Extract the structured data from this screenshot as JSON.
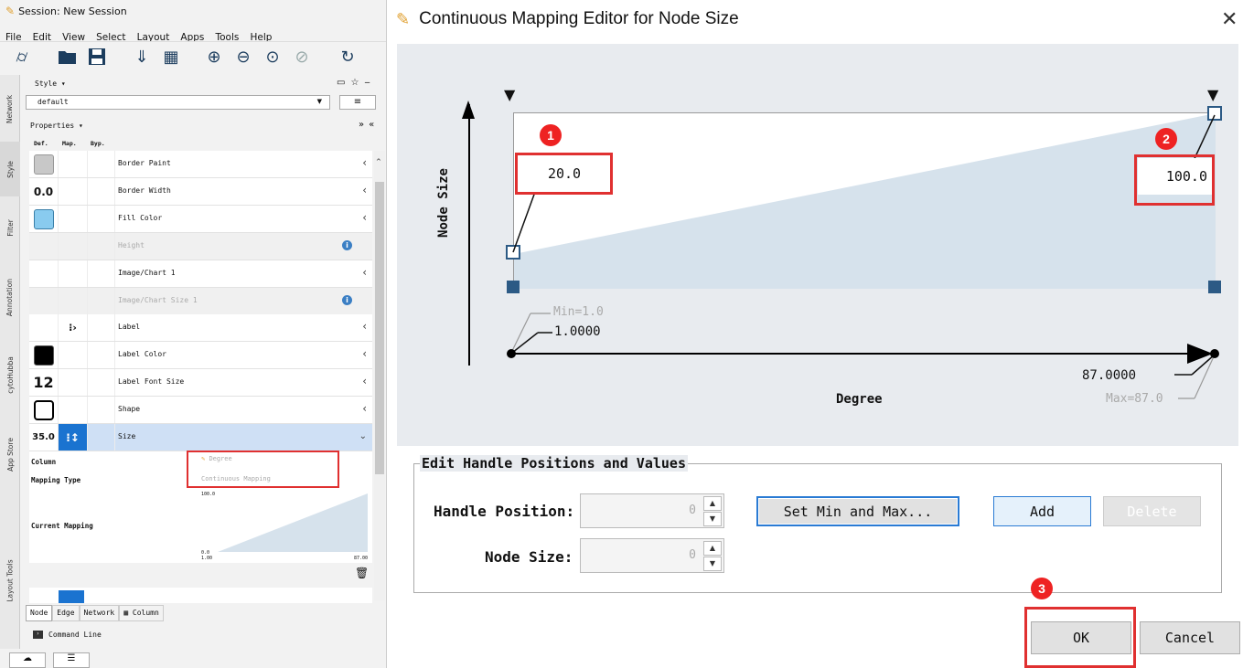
{
  "left_panel": {
    "session_title": "Session: New Session",
    "menu": [
      "File",
      "Edit",
      "View",
      "Select",
      "Layout",
      "Apps",
      "Tools",
      "Help"
    ],
    "toolbar_icons": [
      "network-icon",
      "open-icon",
      "save-icon",
      "import-network-icon",
      "import-table-icon",
      "zoom-in-icon",
      "zoom-out-icon",
      "zoom-fit-icon",
      "zoom-selected-icon",
      "refresh-icon"
    ],
    "side_tabs": [
      "Network",
      "Style",
      "Filter",
      "Annotation",
      "cytoHubba",
      "App Store",
      "Layout Tools"
    ],
    "style_label": "Style ▾",
    "style_value": "default",
    "properties_label": "Properties ▾",
    "col_def": "Def.",
    "col_map": "Map.",
    "col_byp": "Byp.",
    "properties": [
      {
        "name": "Border Paint",
        "def": "",
        "dim": false
      },
      {
        "name": "Border Width",
        "def": "0.0",
        "dim": false
      },
      {
        "name": "Fill Color",
        "def": "",
        "dim": false
      },
      {
        "name": "Height",
        "def": "",
        "dim": true
      },
      {
        "name": "Image/Chart 1",
        "def": "",
        "dim": false
      },
      {
        "name": "Image/Chart Size 1",
        "def": "",
        "dim": true
      },
      {
        "name": "Label",
        "def": "",
        "dim": false
      },
      {
        "name": "Label Color",
        "def": "",
        "dim": false
      },
      {
        "name": "Label Font Size",
        "def": "12",
        "dim": false
      },
      {
        "name": "Shape",
        "def": "",
        "dim": false
      },
      {
        "name": "Size",
        "def": "35.0",
        "dim": false
      }
    ],
    "mapping": {
      "column_label": "Column",
      "column_value": "Degree",
      "type_label": "Mapping Type",
      "type_value": "Continuous Mapping",
      "current_label": "Current Mapping",
      "mini_max": "100.0",
      "mini_min": "0.0",
      "mini_x_min": "1.00",
      "mini_x_max": "87.00"
    },
    "bottom_tabs": [
      "Node",
      "Edge",
      "Network",
      "Column"
    ],
    "command_line": "Command Line"
  },
  "dialog": {
    "title": "Continuous Mapping Editor for Node Size",
    "y_axis_label": "Node Size",
    "x_axis_label": "Degree",
    "left_handle_value": "20.0",
    "right_handle_value": "100.0",
    "x_min_value": "1.0000",
    "x_max_value": "87.0000",
    "x_min_hint": "Min=1.0",
    "x_max_hint": "Max=87.0",
    "edit_group_title": "Edit Handle Positions and Values",
    "handle_position_label": "Handle Position:",
    "handle_position_value": "0",
    "node_size_label": "Node Size:",
    "node_size_value": "0",
    "set_min_max_button": "Set Min and Max...",
    "add_button": "Add",
    "delete_button": "Delete",
    "ok_button": "OK",
    "cancel_button": "Cancel",
    "badges": [
      "1",
      "2",
      "3"
    ],
    "close_glyph": "✕"
  },
  "colors": {
    "highlight_red": "#e03030",
    "area_fill": "#d6e2ec",
    "selected_row": "#cfe0f5",
    "handle_blue": "#2c5a85"
  }
}
